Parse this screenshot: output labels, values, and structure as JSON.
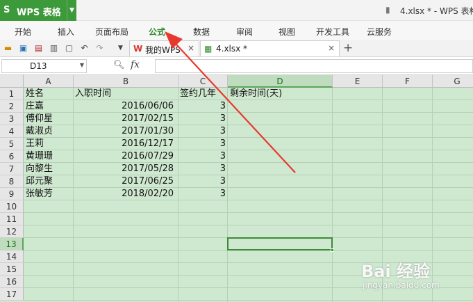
{
  "app": {
    "name": "WPS 表格",
    "logo_letter": "S",
    "window_title": "4.xlsx * - WPS 表格"
  },
  "ribbon_tabs": [
    "开始",
    "插入",
    "页面布局",
    "公式",
    "数据",
    "审阅",
    "视图",
    "开发工具",
    "云服务"
  ],
  "active_ribbon_tab": "公式",
  "doc_tabs": [
    {
      "label": "我的WPS",
      "close": "×"
    },
    {
      "label": "4.xlsx *",
      "close": "×"
    }
  ],
  "new_tab_symbol": "+",
  "formula_bar": {
    "cell_name": "D13",
    "fx_label": "fx",
    "formula": ""
  },
  "columns": [
    "A",
    "B",
    "C",
    "D",
    "E",
    "F",
    "G"
  ],
  "selected_column": "D",
  "rows": [
    "1",
    "2",
    "3",
    "4",
    "5",
    "6",
    "7",
    "8",
    "9",
    "10",
    "11",
    "12",
    "13",
    "14",
    "15",
    "16",
    "17"
  ],
  "selected_row": "13",
  "table": {
    "headers": [
      "姓名",
      "入职时间",
      "签约几年",
      "剩余时间(天)"
    ],
    "data": [
      [
        "庄嘉",
        "2016/06/06",
        "3"
      ],
      [
        "傅仰星",
        "2017/02/15",
        "3"
      ],
      [
        "戴淑贞",
        "2017/01/30",
        "3"
      ],
      [
        "王莉",
        "2016/12/17",
        "3"
      ],
      [
        "黄珊珊",
        "2016/07/29",
        "3"
      ],
      [
        "向黎生",
        "2017/05/28",
        "3"
      ],
      [
        "邱元聚",
        "2017/06/25",
        "3"
      ],
      [
        "张敏芳",
        "2018/02/20",
        "3"
      ]
    ]
  },
  "watermark": {
    "text": "Bai 经验",
    "sub": "jingyan.baidu.com"
  },
  "colors": {
    "brand_green": "#3c9a3a",
    "annotation_red": "#e8392f",
    "grid_fill": "#cfe8d0"
  }
}
